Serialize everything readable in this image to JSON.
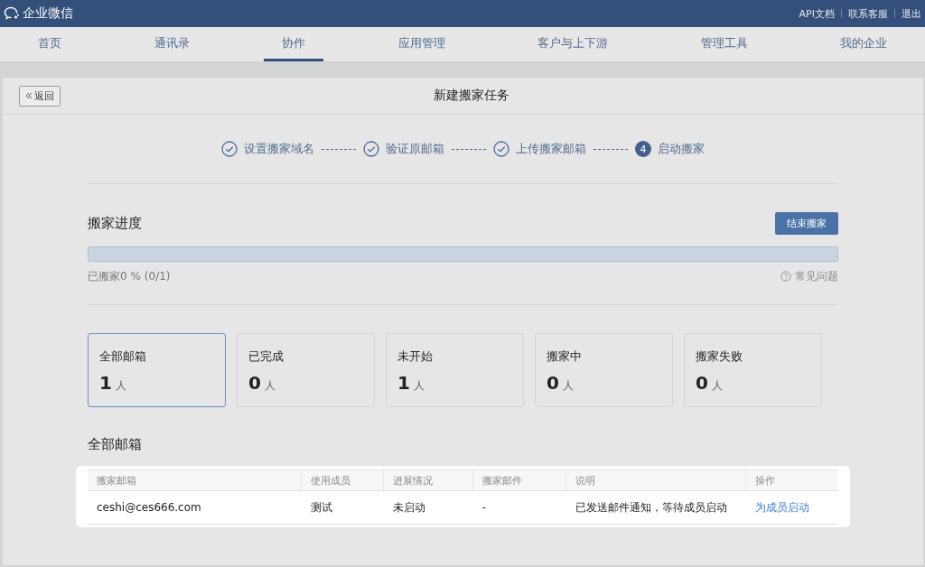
{
  "top_bar": {
    "logo_text": "企业微信",
    "links": [
      "API文档",
      "联系客服",
      "退出"
    ]
  },
  "tabs": [
    {
      "label": "首页",
      "selected": false
    },
    {
      "label": "通讯录",
      "selected": false
    },
    {
      "label": "协作",
      "selected": true
    },
    {
      "label": "应用管理",
      "selected": false
    },
    {
      "label": "客户与上下游",
      "selected": false
    },
    {
      "label": "管理工具",
      "selected": false
    },
    {
      "label": "我的企业",
      "selected": false
    }
  ],
  "page": {
    "back_button": "返回",
    "title": "新建搬家任务"
  },
  "steps": [
    {
      "label": "设置搬家域名",
      "kind": "done"
    },
    {
      "label": "验证原邮箱",
      "kind": "done"
    },
    {
      "label": "上传搬家邮箱",
      "kind": "done"
    },
    {
      "label": "启动搬家",
      "kind": "current",
      "number": "4"
    }
  ],
  "progress": {
    "heading": "搬家进度",
    "end_button": "结束搬家",
    "level": 0,
    "reading": "已搬家0 %",
    "count": "(0/1)",
    "help_link": "常见问题"
  },
  "stats": [
    {
      "label": "全部邮箱",
      "value": "1",
      "unit": "人",
      "selected": true
    },
    {
      "label": "已完成",
      "value": "0",
      "unit": "人",
      "selected": false
    },
    {
      "label": "未开始",
      "value": "1",
      "unit": "人",
      "selected": false
    },
    {
      "label": "搬家中",
      "value": "0",
      "unit": "人",
      "selected": false
    },
    {
      "label": "搬家失败",
      "value": "0",
      "unit": "人",
      "selected": false
    }
  ],
  "table": {
    "heading": "全部邮箱",
    "columns": [
      "搬家邮箱",
      "使用成员",
      "进展情况",
      "搬家邮件",
      "说明",
      "操作"
    ],
    "rows": [
      {
        "cells": [
          "ceshi@ces666.com",
          "测试",
          "未启动",
          "-",
          "已发送邮件通知，等待成员启动"
        ],
        "action": "为成员启动"
      }
    ]
  }
}
